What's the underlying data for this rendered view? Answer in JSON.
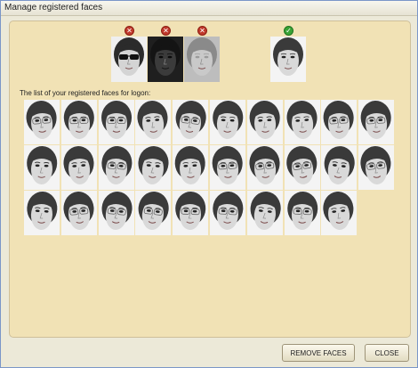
{
  "window": {
    "title": "Manage registered faces"
  },
  "examples": [
    {
      "status": "bad",
      "variant": "sunglasses",
      "badge_icon": "x-mark-icon"
    },
    {
      "status": "bad",
      "variant": "dark",
      "badge_icon": "x-mark-icon"
    },
    {
      "status": "bad",
      "variant": "blurry",
      "badge_icon": "x-mark-icon"
    },
    {
      "status": "good",
      "variant": "good",
      "badge_icon": "check-mark-icon"
    }
  ],
  "list": {
    "label": "The list of your registered faces for logon:",
    "rows": [
      10,
      10,
      9
    ]
  },
  "buttons": {
    "remove": "REMOVE FACES",
    "close": "CLOSE"
  },
  "colors": {
    "panel": "#f1e2b5",
    "bad_badge": "#c0392b",
    "good_badge": "#3aa335"
  }
}
